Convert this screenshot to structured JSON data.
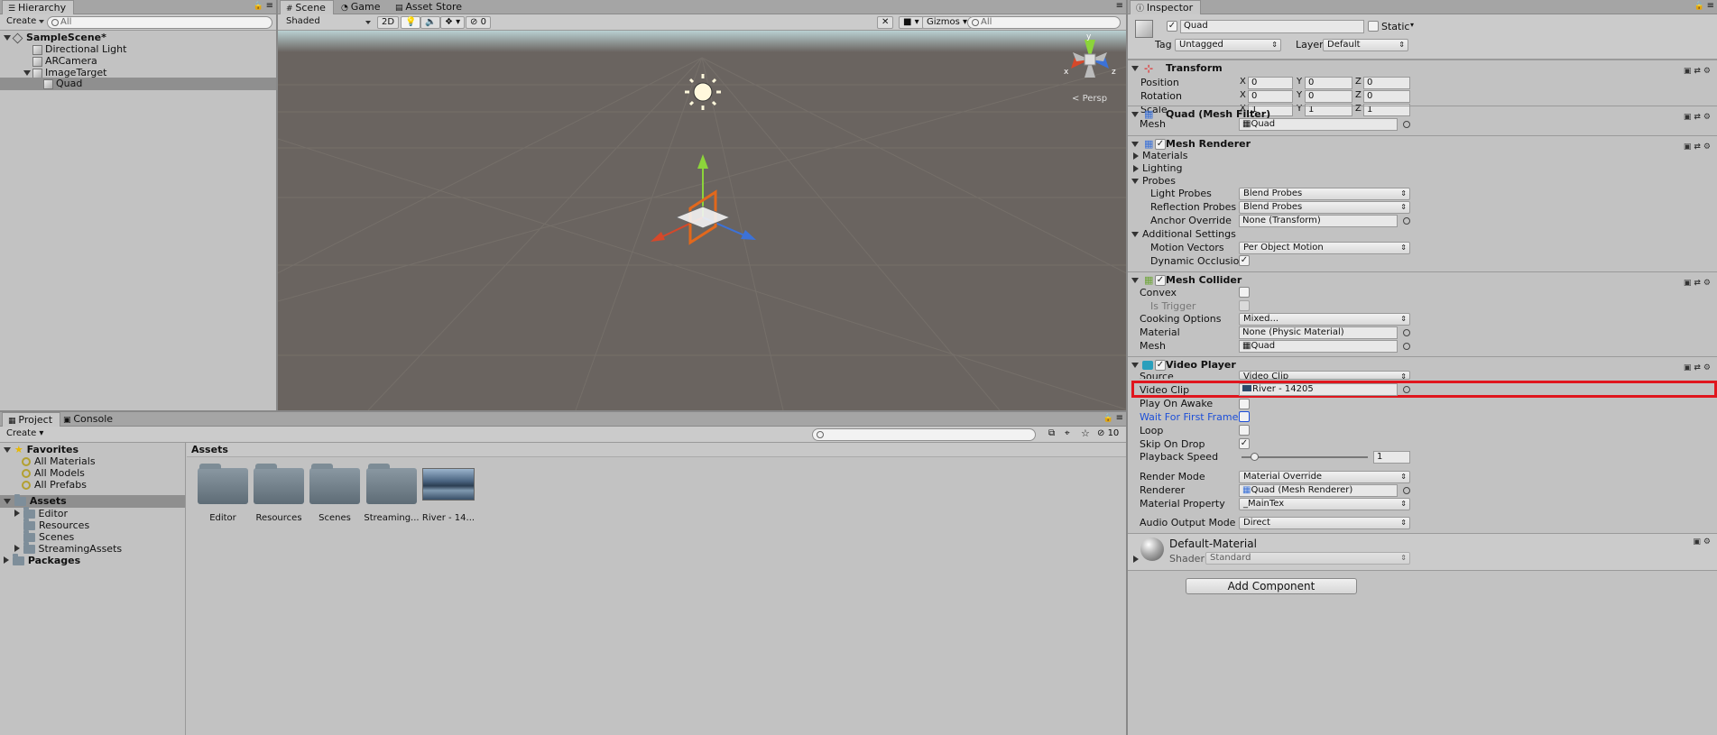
{
  "hierarchy": {
    "tab": "Hierarchy",
    "create": "Create",
    "search_placeholder": "All",
    "items": [
      "SampleScene*",
      "Directional Light",
      "ARCamera",
      "ImageTarget",
      "Quad"
    ]
  },
  "scene": {
    "tabs": [
      "Scene",
      "Game",
      "Asset Store"
    ],
    "shading": "Shaded",
    "btn_2d": "2D",
    "hidden_count": "0",
    "gizmos": "Gizmos",
    "search_placeholder": "All",
    "persp": "Persp",
    "axes": {
      "x": "x",
      "y": "y",
      "z": "z"
    }
  },
  "project": {
    "tabs": [
      "Project",
      "Console"
    ],
    "create": "Create",
    "favorites": "Favorites",
    "favorite_items": [
      "All Materials",
      "All Models",
      "All Prefabs"
    ],
    "assets": "Assets",
    "asset_folders": [
      "Editor",
      "Resources",
      "Scenes",
      "StreamingAssets"
    ],
    "packages": "Packages",
    "breadcrumb": "Assets",
    "grid_items": [
      "Editor",
      "Resources",
      "Scenes",
      "Streaming...",
      "River - 14..."
    ],
    "count": "10"
  },
  "inspector": {
    "tab": "Inspector",
    "object_name": "Quad",
    "static_label": "Static",
    "tag_label": "Tag",
    "tag_value": "Untagged",
    "layer_label": "Layer",
    "layer_value": "Default",
    "transform": {
      "title": "Transform",
      "position_label": "Position",
      "rotation_label": "Rotation",
      "scale_label": "Scale",
      "position": [
        "0",
        "0",
        "0"
      ],
      "rotation": [
        "0",
        "0",
        "0"
      ],
      "scale": [
        "1",
        "1",
        "1"
      ]
    },
    "mesh_filter": {
      "title": "Quad (Mesh Filter)",
      "mesh_label": "Mesh",
      "mesh_value": "Quad"
    },
    "mesh_renderer": {
      "title": "Mesh Renderer",
      "materials": "Materials",
      "lighting": "Lighting",
      "probes": "Probes",
      "light_probes_label": "Light Probes",
      "light_probes_value": "Blend Probes",
      "reflection_probes_label": "Reflection Probes",
      "reflection_probes_value": "Blend Probes",
      "anchor_override_label": "Anchor Override",
      "anchor_override_value": "None (Transform)",
      "additional": "Additional Settings",
      "motion_vectors_label": "Motion Vectors",
      "motion_vectors_value": "Per Object Motion",
      "dynamic_occlusion_label": "Dynamic Occlusion"
    },
    "mesh_collider": {
      "title": "Mesh Collider",
      "convex_label": "Convex",
      "is_trigger_label": "Is Trigger",
      "cooking_label": "Cooking Options",
      "cooking_value": "Mixed...",
      "material_label": "Material",
      "material_value": "None (Physic Material)",
      "mesh_label": "Mesh",
      "mesh_value": "Quad"
    },
    "video_player": {
      "title": "Video Player",
      "source_label": "Source",
      "source_value": "Video Clip",
      "clip_label": "Video Clip",
      "clip_value": "River - 14205",
      "play_on_awake_label": "Play On Awake",
      "wait_label": "Wait For First Frame",
      "loop_label": "Loop",
      "skip_label": "Skip On Drop",
      "speed_label": "Playback Speed",
      "speed_value": "1",
      "speed_fraction": 0.1,
      "render_mode_label": "Render Mode",
      "render_mode_value": "Material Override",
      "renderer_label": "Renderer",
      "renderer_value": "Quad (Mesh Renderer)",
      "material_property_label": "Material Property",
      "material_property_value": "_MainTex",
      "audio_label": "Audio Output Mode",
      "audio_value": "Direct"
    },
    "material": {
      "name": "Default-Material",
      "shader_label": "Shader",
      "shader_value": "Standard"
    },
    "add_component": "Add Component"
  },
  "colors": {
    "highlight": "#e0161e",
    "selection": "#8f8f8f",
    "link_blue": "#1d4fd8"
  }
}
